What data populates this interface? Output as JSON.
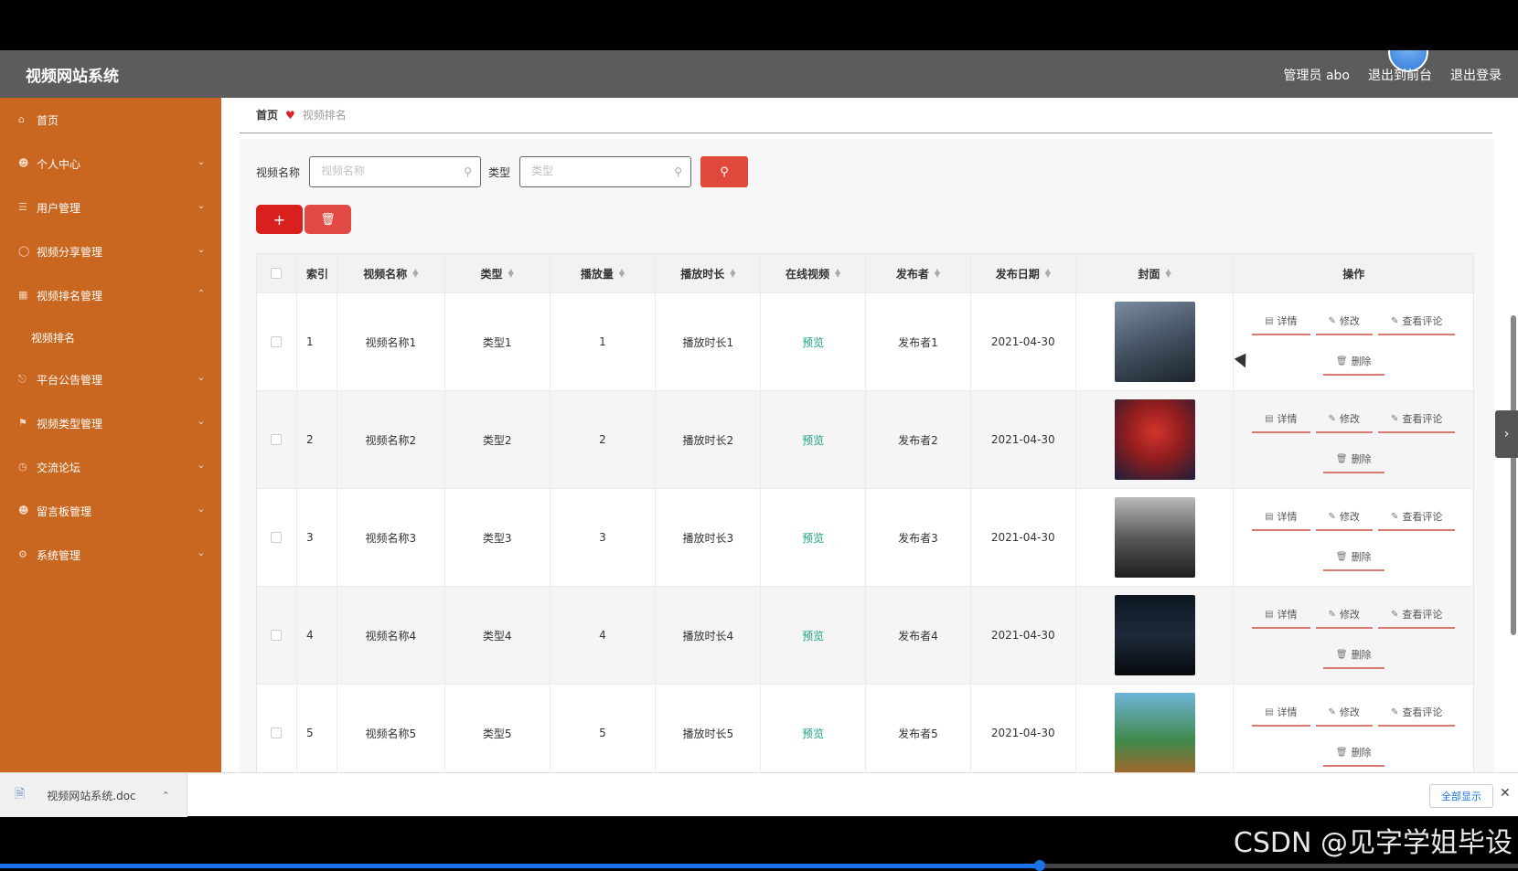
{
  "header": {
    "app_title": "视频网站系统",
    "admin_label": "管理员 abo",
    "back_to_front": "退出到前台",
    "logout": "退出登录"
  },
  "sidebar": {
    "items": [
      {
        "label": "首页",
        "icon": "home-icon"
      },
      {
        "label": "个人中心",
        "icon": "user-icon"
      },
      {
        "label": "用户管理",
        "icon": "list-icon"
      },
      {
        "label": "视频分享管理",
        "icon": "share-icon"
      },
      {
        "label": "视频排名管理",
        "icon": "chart-icon"
      },
      {
        "label": "视频排名",
        "icon": ""
      },
      {
        "label": "平台公告管理",
        "icon": "power-icon"
      },
      {
        "label": "视频类型管理",
        "icon": "tag-icon"
      },
      {
        "label": "交流论坛",
        "icon": "clock-icon"
      },
      {
        "label": "留言板管理",
        "icon": "user-icon"
      },
      {
        "label": "系统管理",
        "icon": "gear-icon"
      }
    ]
  },
  "breadcrumb": {
    "home": "首页",
    "current": "视频排名"
  },
  "search": {
    "name_label": "视频名称",
    "name_placeholder": "视频名称",
    "type_label": "类型",
    "type_placeholder": "类型"
  },
  "table": {
    "headers": [
      "索引",
      "视频名称",
      "类型",
      "播放量",
      "播放时长",
      "在线视频",
      "发布者",
      "发布日期",
      "封面",
      "操作"
    ],
    "rows": [
      {
        "idx": "1",
        "name": "视频名称1",
        "type": "类型1",
        "plays": "1",
        "duration": "播放时长1",
        "online": "预览",
        "publisher": "发布者1",
        "date": "2021-04-30",
        "cover_color": "#3f4d5c"
      },
      {
        "idx": "2",
        "name": "视频名称2",
        "type": "类型2",
        "plays": "2",
        "duration": "播放时长2",
        "online": "预览",
        "publisher": "发布者2",
        "date": "2021-04-30",
        "cover_color": "#8f1d1d"
      },
      {
        "idx": "3",
        "name": "视频名称3",
        "type": "类型3",
        "plays": "3",
        "duration": "播放时长3",
        "online": "预览",
        "publisher": "发布者3",
        "date": "2021-04-30",
        "cover_color": "#5a5a5a"
      },
      {
        "idx": "4",
        "name": "视频名称4",
        "type": "类型4",
        "plays": "4",
        "duration": "播放时长4",
        "online": "预览",
        "publisher": "发布者4",
        "date": "2021-04-30",
        "cover_color": "#1e2a3a"
      },
      {
        "idx": "5",
        "name": "视频名称5",
        "type": "类型5",
        "plays": "5",
        "duration": "播放时长5",
        "online": "预览",
        "publisher": "发布者5",
        "date": "2021-04-30",
        "cover_color": "#3f8a4a"
      }
    ],
    "ops": {
      "detail": "详情",
      "edit": "修改",
      "comments": "查看评论",
      "delete": "删除"
    }
  },
  "download_bar": {
    "file_name": "视频网站系统.doc",
    "show_all": "全部显示"
  },
  "watermark": "CSDN @见字学姐毕设"
}
